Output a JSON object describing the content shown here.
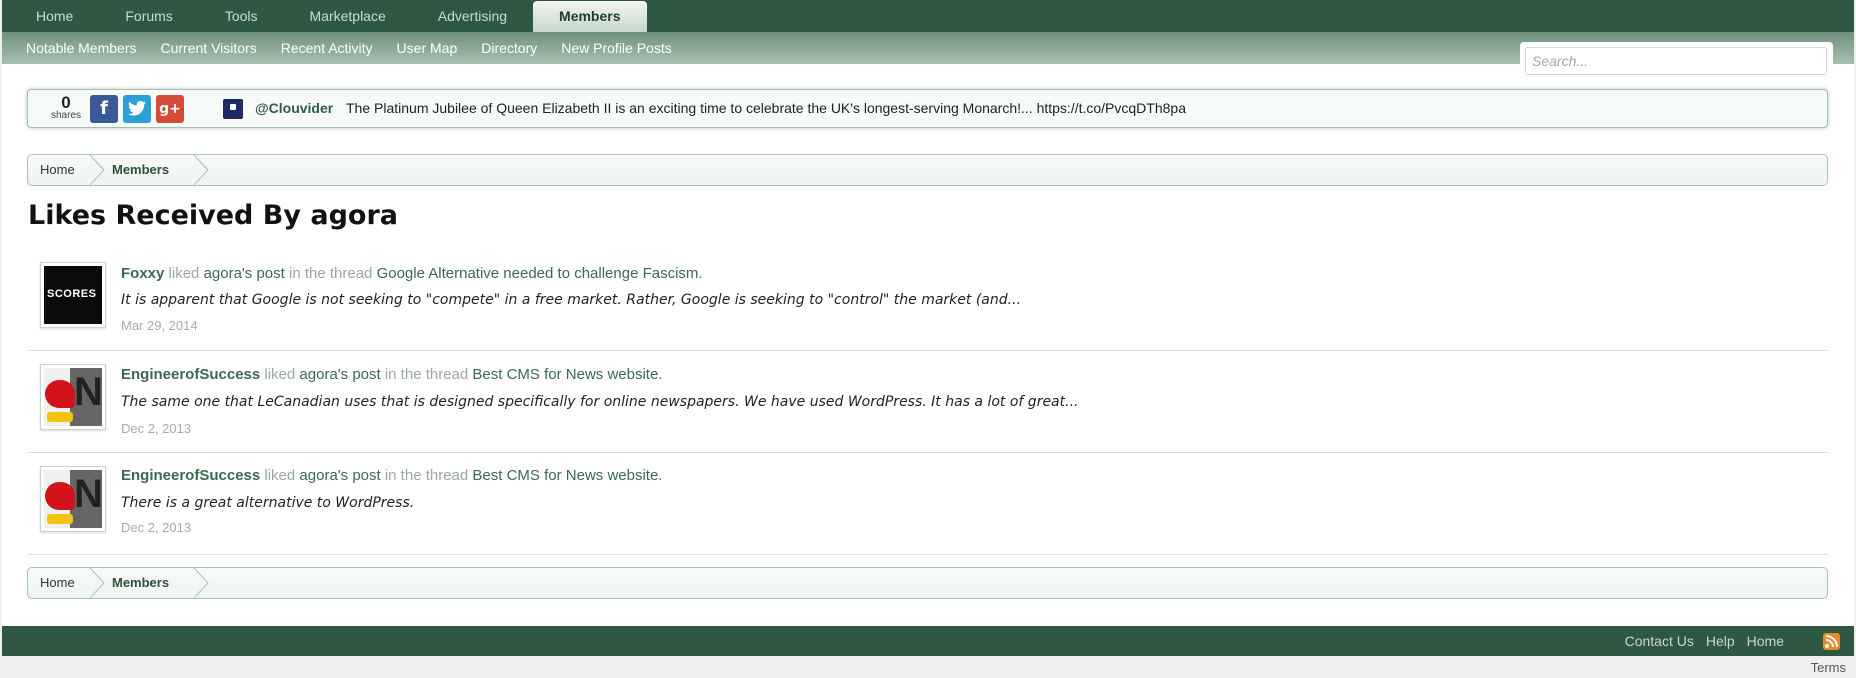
{
  "nav": {
    "tabs": [
      "Home",
      "Forums",
      "Tools",
      "Marketplace",
      "Advertising",
      "Members"
    ],
    "active_tab": "Members",
    "subnav": [
      "Notable Members",
      "Current Visitors",
      "Recent Activity",
      "User Map",
      "Directory",
      "New Profile Posts"
    ]
  },
  "search": {
    "placeholder": "Search..."
  },
  "sharebar": {
    "count": "0",
    "count_label": "shares",
    "buttons": [
      "facebook-icon",
      "twitter-icon",
      "google-plus-icon"
    ],
    "tweet_handle": "@Clouvider",
    "tweet_text": "The Platinum Jubilee of Queen Elizabeth II is an exciting time to celebrate the UK's longest-serving Monarch!... https://t.co/PvcqDTh8pa"
  },
  "breadcrumb": [
    "Home",
    "Members"
  ],
  "page_title": "Likes Received By agora",
  "likes": [
    {
      "user": "Foxxy",
      "avatar": "scores-avatar",
      "w_liked": "liked",
      "post_link": "agora's post",
      "w_in": "in the thread",
      "thread": "Google Alternative needed to challenge Fascism.",
      "snippet": "It is apparent that Google is not seeking to \"compete\" in a free market. Rather, Google is seeking to \"control\" the market (and...",
      "date": "Mar 29, 2014"
    },
    {
      "user": "EngineerofSuccess",
      "avatar": "i-love-ny-avatar",
      "w_liked": "liked",
      "post_link": "agora's post",
      "w_in": "in the thread",
      "thread": "Best CMS for News website.",
      "snippet": "The same one that LeCanadian uses that is designed specifically for online newspapers. We have used WordPress. It has a lot of great...",
      "date": "Dec 2, 2013"
    },
    {
      "user": "EngineerofSuccess",
      "avatar": "i-love-ny-avatar",
      "w_liked": "liked",
      "post_link": "agora's post",
      "w_in": "in the thread",
      "thread": "Best CMS for News website.",
      "snippet": "There is a great alternative to WordPress.",
      "date": "Dec 2, 2013"
    }
  ],
  "footer": {
    "links": [
      "Contact Us",
      "Help",
      "Home"
    ],
    "rss": "rss-icon",
    "terms": "Terms"
  },
  "colors": {
    "nav_dark": "#2f5843",
    "link_green": "#3a6a52",
    "muted": "#9aa89f"
  }
}
